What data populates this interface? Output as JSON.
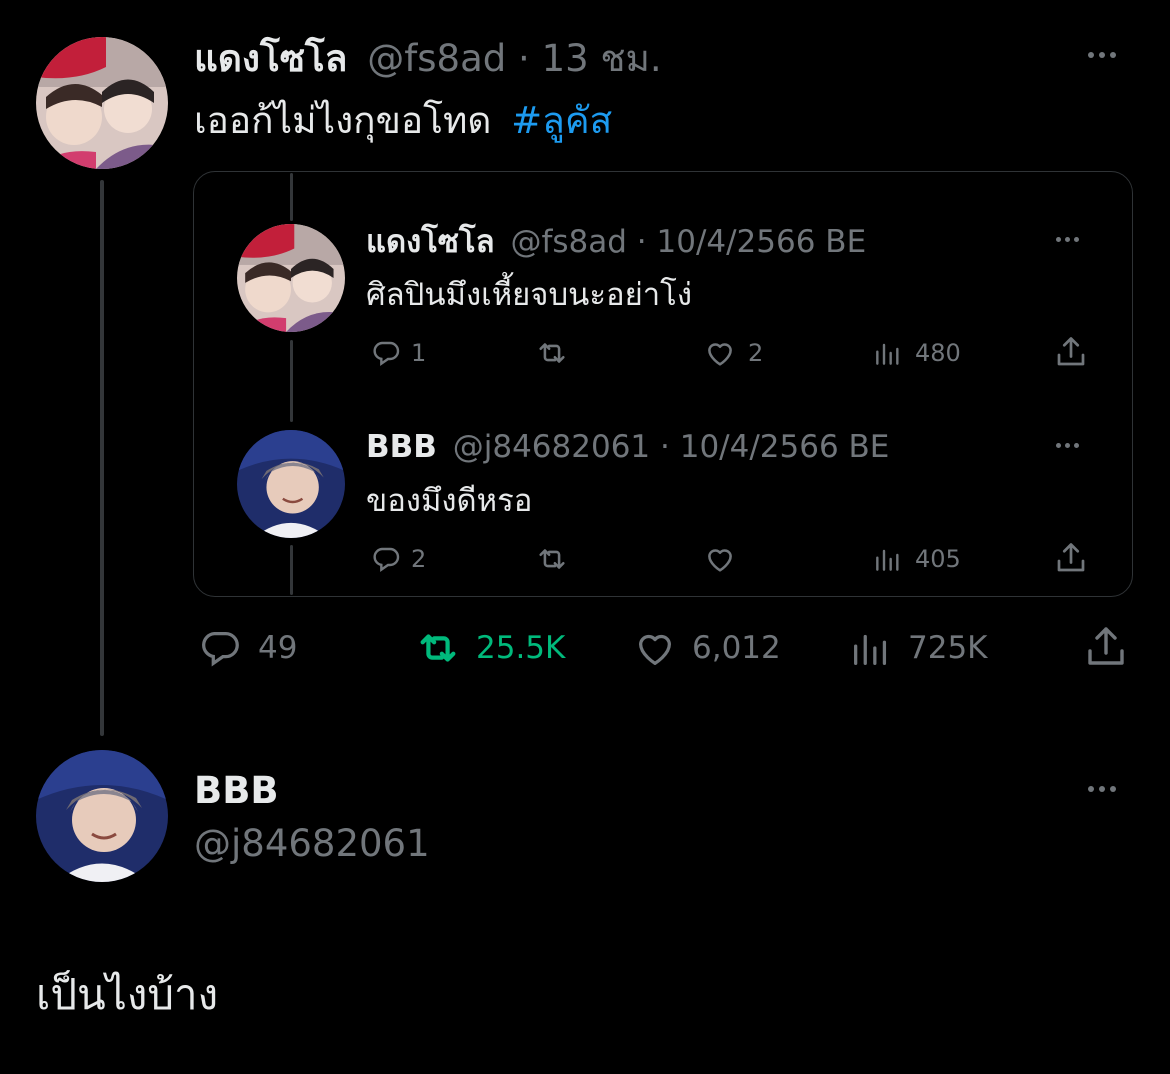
{
  "main_tweet": {
    "display_name": "แดงโซโล",
    "handle": "@fs8ad",
    "separator": "·",
    "time": "13 ชม.",
    "text": "เออก้ไม่ไงกุขอโทด",
    "hashtag": "#ลูคัส",
    "actions": {
      "replies": "49",
      "retweets": "25.5K",
      "likes": "6,012",
      "views": "725K"
    }
  },
  "quoted_thread": [
    {
      "display_name": "แดงโซโล",
      "handle": "@fs8ad",
      "separator": "·",
      "date": "10/4/2566 BE",
      "text": "ศิลปินมึงเหี้ยจบนะอย่าโง่",
      "actions": {
        "replies": "1",
        "retweets": "",
        "likes": "2",
        "views": "480"
      }
    },
    {
      "display_name": "BBB",
      "handle": "@j84682061",
      "separator": "·",
      "date": "10/4/2566 BE",
      "text": "ของมึงดีหรอ",
      "actions": {
        "replies": "2",
        "retweets": "",
        "likes": "",
        "views": "405"
      }
    }
  ],
  "reply_tweet": {
    "display_name": "BBB",
    "handle": "@j84682061",
    "text": "เป็นไงบ้าง"
  },
  "colors": {
    "background": "#000000",
    "text": "#e7e9ea",
    "muted": "#71767b",
    "link": "#1d9bf0",
    "retweet_active": "#00ba7c",
    "border": "#2f3336"
  },
  "icons": [
    "more-icon",
    "reply-icon",
    "retweet-icon",
    "like-icon",
    "views-icon",
    "share-icon"
  ]
}
